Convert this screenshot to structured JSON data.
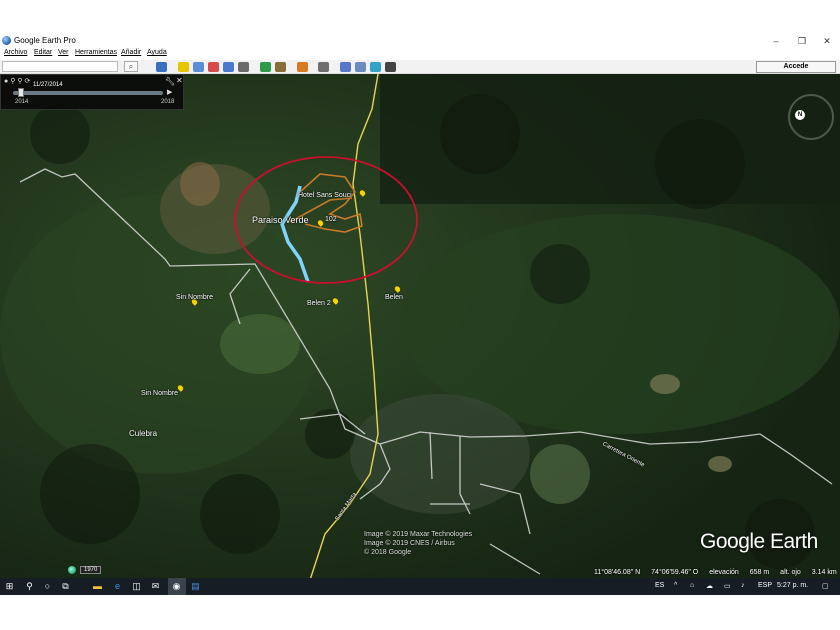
{
  "window": {
    "title": "Google Earth Pro",
    "controls": [
      "–",
      "❐",
      "✕"
    ]
  },
  "menu": {
    "items": [
      "Archivo",
      "Editar",
      "Ver",
      "Herramientas",
      "Añadir",
      "Ayuda"
    ]
  },
  "toolbar": {
    "search_placeholder": "",
    "signin_label": "Accede",
    "icon_colors": [
      "#3b6fbf",
      "#e7c600",
      "#5a8fd8",
      "#d94b4b",
      "#4a7ad0",
      "#6b6b6b",
      "#2f9b4a",
      "#8a6e3a",
      "#d87a22",
      "#6e6e6e",
      "#5577cc",
      "#6c8bbf",
      "#33a2c9",
      "#444444",
      "#888888"
    ]
  },
  "time_slider": {
    "date": "11/27/2014",
    "start_year": "2014",
    "end_year": "2018",
    "position": 0.05
  },
  "map": {
    "places": [
      {
        "id": "hotel",
        "label": "Hotel Sans Souci"
      },
      {
        "id": "paraiso",
        "label": "Paraiso Verde"
      },
      {
        "id": "num102",
        "label": "102"
      },
      {
        "id": "sinnombre1",
        "label": "Sin Nombre"
      },
      {
        "id": "belen2",
        "label": "Belen 2"
      },
      {
        "id": "belen",
        "label": "Belen"
      },
      {
        "id": "sinnombre2",
        "label": "Sin Nombre"
      },
      {
        "id": "culebra",
        "label": "Culebra"
      },
      {
        "id": "santamarta",
        "label": "Santa Marta"
      },
      {
        "id": "ruta",
        "label": "Carretera Oriente"
      }
    ],
    "credits": [
      "Image © 2019 Maxar Technologies",
      "Image © 2019 CNES / Airbus",
      "© 2018 Google"
    ],
    "logo": "Google Earth",
    "history_year": "1970",
    "compass_label": "N",
    "colors": {
      "circle": "#c8102e",
      "river": "#7fd3ff",
      "track": "#c87a2a",
      "road": "#dedede",
      "highway": "#e6d550"
    }
  },
  "status": {
    "lat": "11°08'46.08\" N",
    "lon": "74°06'59.46\" O",
    "elev_label": "elevación",
    "elev_value": "658 m",
    "eye_label": "alt. ojo",
    "eye_value": "3.14 km"
  },
  "taskbar": {
    "lang": "ES",
    "layout": "ESP",
    "time": "5:27 p. m."
  }
}
